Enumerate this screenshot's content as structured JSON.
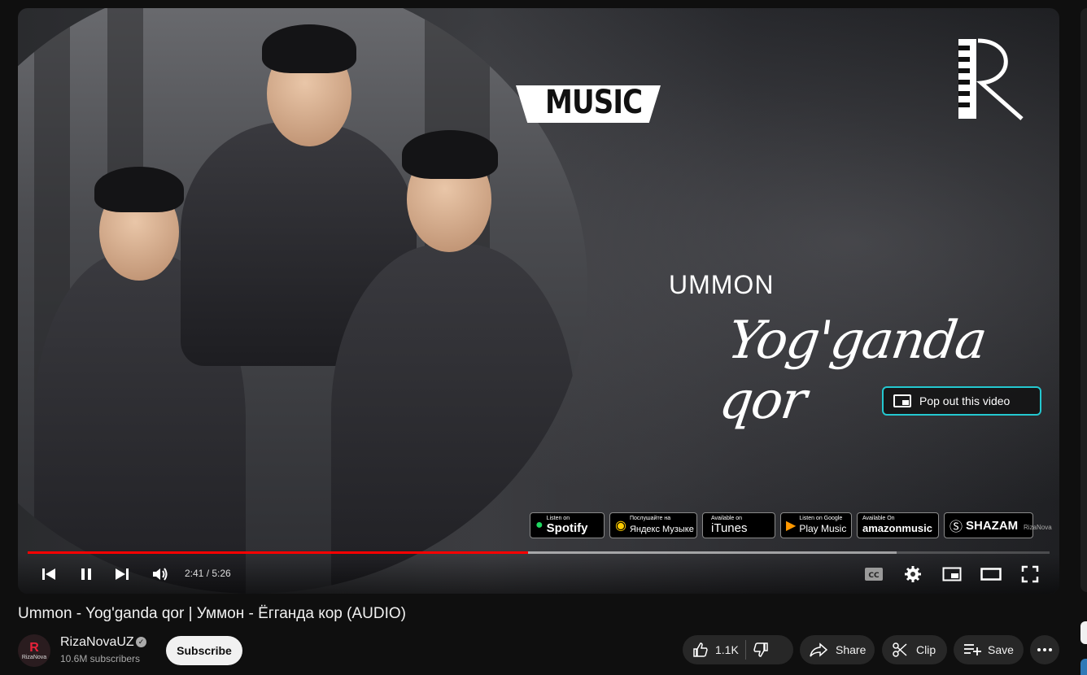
{
  "player": {
    "thumbnail_text": {
      "music_tag": "MUSIC",
      "artist": "UMMON",
      "song": "Yog'ganda qor",
      "watermark": "RizaNova"
    },
    "pop_out_label": "Pop out this video",
    "store_badges": [
      {
        "small": "Listen on",
        "big": "Spotify",
        "icon": "spotify-icon"
      },
      {
        "small": "Послушайте на",
        "big": "Яндекс Музыке",
        "icon": "yandex-music-icon"
      },
      {
        "small": "Available on",
        "big": "iTunes",
        "icon": "apple-icon"
      },
      {
        "small": "Listen on Google",
        "big": "Play Music",
        "icon": "google-play-icon"
      },
      {
        "small": "Available On",
        "big": "amazonmusic",
        "icon": "amazon-icon"
      },
      {
        "small": "",
        "big": "SHAZAM",
        "icon": "shazam-icon"
      }
    ],
    "progress": {
      "played_fraction": 0.49,
      "buffered_fraction": 0.85
    },
    "time": {
      "current": "2:41",
      "separator": " / ",
      "duration": "5:26"
    },
    "colors": {
      "progress_red": "#ff0000",
      "popout_border": "#24c8d0"
    }
  },
  "video": {
    "title": "Ummon - Yog'ganda qor | Уммон - Ёгганда кор (AUDIO)"
  },
  "channel": {
    "name": "RizaNovaUZ",
    "subscribers": "10.6M subscribers",
    "subscribe_label": "Subscribe",
    "avatar_text": "RizaNova"
  },
  "actions": {
    "likes": "1.1K",
    "share": "Share",
    "clip": "Clip",
    "save": "Save"
  }
}
